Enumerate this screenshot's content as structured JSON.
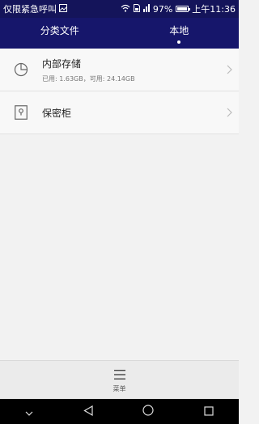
{
  "status_bar": {
    "carrier_text": "仅限紧急呼叫",
    "battery_percent": "97%",
    "battery_level": 0.97,
    "time": "上午11:36",
    "icons": [
      "image-icon",
      "wifi-icon",
      "sim-icon",
      "signal-icon",
      "battery-icon"
    ]
  },
  "tabs": [
    {
      "label": "分类文件",
      "active": false
    },
    {
      "label": "本地",
      "active": true
    }
  ],
  "storage_items": [
    {
      "title": "内部存储",
      "subtitle": "已用: 1.63GB，可用: 24.14GB",
      "icon": "pie-chart-icon"
    },
    {
      "title": "保密柜",
      "subtitle": "",
      "icon": "safe-icon"
    }
  ],
  "bottom_bar": {
    "menu_label": "菜单",
    "icon": "menu-icon"
  },
  "nav_bar": {
    "icons": [
      "collapse-icon",
      "back-icon",
      "home-icon",
      "recents-icon"
    ]
  },
  "colors": {
    "header": "#16166b",
    "status": "#14145a",
    "background": "#f2f2f2",
    "list_bg": "#f8f8f8"
  }
}
